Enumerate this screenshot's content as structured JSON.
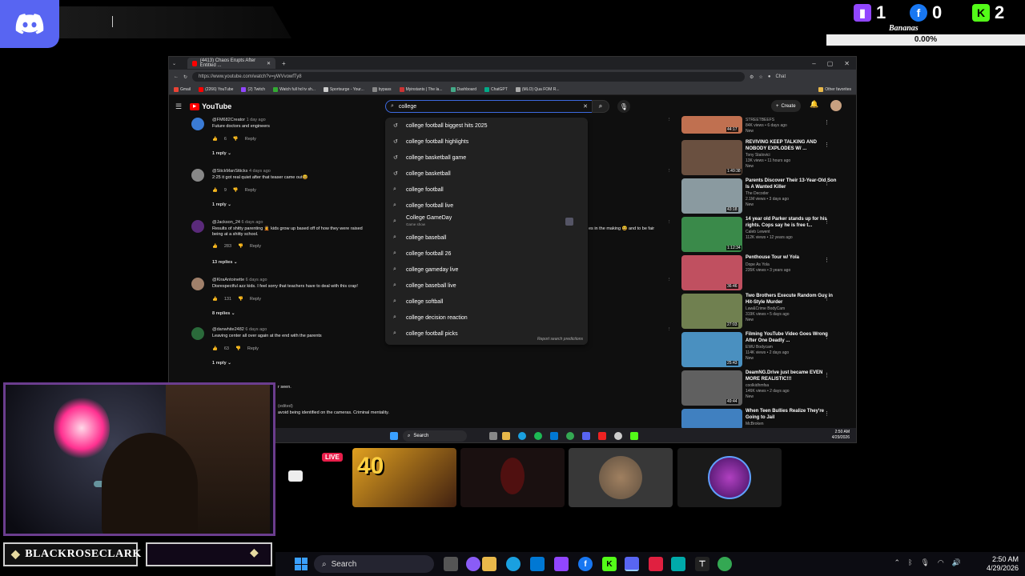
{
  "overlay": {
    "social": [
      {
        "icon": "twitch-icon",
        "count": "1",
        "color": "#9146ff"
      },
      {
        "icon": "facebook-icon",
        "count": "0",
        "color": "#1877f2"
      },
      {
        "icon": "kick-icon",
        "count": "2",
        "color": "#53fc18"
      }
    ],
    "bananas_label": "Bananas",
    "bananas_value": "0.00%",
    "streamer_name": "BLACKROSECLARK",
    "live_badge": "LIVE",
    "tile_text": "40"
  },
  "browser": {
    "tab_title": "(4413) Chaos Erupts After Entitled ...",
    "url": "https://www.youtube.com/watch?v=yWVvowfTy8",
    "bookmarks": [
      "Gmail",
      "(2266) YouTube",
      "(2) Twitch",
      "Watch full hd tv sh...",
      "Sportsurge - Your...",
      "bypass",
      "Myinstants | The la...",
      "Dashboard",
      "ChatGPT",
      "(MLO) Qua FOM R...",
      "Other favorites"
    ],
    "chat_label": "Chat"
  },
  "youtube": {
    "logo": "YouTube",
    "search_value": "college",
    "create_label": "Create",
    "notif_count": "9+",
    "suggestions": [
      {
        "icon": "history",
        "text": "college football biggest hits 2025"
      },
      {
        "icon": "history",
        "text": "college football highlights"
      },
      {
        "icon": "history",
        "text": "college basketball game"
      },
      {
        "icon": "history",
        "text": "college basketball"
      },
      {
        "icon": "search",
        "text": "college football"
      },
      {
        "icon": "search",
        "text": "college football live"
      },
      {
        "icon": "search",
        "text": "College GameDay",
        "sub": "Game show"
      },
      {
        "icon": "search",
        "text": "college baseball"
      },
      {
        "icon": "search",
        "text": "college football 26"
      },
      {
        "icon": "search",
        "text": "college gameday live"
      },
      {
        "icon": "search",
        "text": "college baseball live"
      },
      {
        "icon": "search",
        "text": "college softball"
      },
      {
        "icon": "search",
        "text": "college decision reaction"
      },
      {
        "icon": "search",
        "text": "college football picks"
      }
    ],
    "report_label": "Report search predictions",
    "comments": [
      {
        "author": "@FM682Creator",
        "time": "1 day ago",
        "text": "Future doctors and engineers",
        "likes": "6",
        "reply": "Reply",
        "replies": "1 reply",
        "avatar": "#3a7bd5"
      },
      {
        "author": "@StickManStticks",
        "time": "4 days ago",
        "text": "2:25 it got real quiet after that teaser came out😆",
        "likes": "9",
        "reply": "Reply",
        "replies": "1 reply",
        "avatar": "#888"
      },
      {
        "author": "@Jackson_24",
        "time": "6 days ago",
        "text": "Results of shitty parenting 🤦 kids grow up based off of how they were raised",
        "text2": "es in the making 😆 and to be fair",
        "text3": "being at a shitty school.",
        "likes": "283",
        "reply": "Reply",
        "replies": "13 replies",
        "avatar": "#5a2a7a"
      },
      {
        "author": "@KiraAntoinette",
        "time": "6 days ago",
        "text": "Disrespectful azz kids. I feel sorry that teachers have to deal with this crap!",
        "likes": "131",
        "reply": "Reply",
        "replies": "8 replies",
        "avatar": "#a0806a"
      },
      {
        "author": "@danwhite2482",
        "time": "6 days ago",
        "text": "Leaving center all over again at the end with the parents",
        "likes": "63",
        "reply": "Reply",
        "replies": "1 reply",
        "avatar": "#2a6a3a"
      }
    ],
    "partial_text_1": "r seen.",
    "partial_text_2": "(edited)",
    "partial_text_3": "avoid being identified on the cameras.  Criminal mentality.",
    "related": [
      {
        "title": "",
        "channel": "STREETBEEFS",
        "meta": "84K views • 6 days ago",
        "badge": "New",
        "duration": "44:17",
        "color": "#c07050"
      },
      {
        "title": "REVIVING KEEP TALKING AND NOBODY EXPLODES W/ ...",
        "channel": "Tony Stalovici",
        "meta": "13K views • 11 hours ago",
        "badge": "New",
        "duration": "1:49:38",
        "color": "#6a5040"
      },
      {
        "title": "Parents Discover Their 13-Year-Old Son Is A Wanted Killer",
        "channel": "The Decoder",
        "meta": "2.1M views • 3 days ago",
        "badge": "New",
        "duration": "43:18",
        "color": "#8a9aa0"
      },
      {
        "title": "14 year old Parker stands up for his rights. Cops say he is free t...",
        "channel": "Caleb Lewent",
        "meta": "112K views • 12 years ago",
        "badge": "",
        "duration": "1:12:34",
        "color": "#3a8a4a"
      },
      {
        "title": "Penthouse Tour w/ Yola",
        "channel": "Dope As Yola",
        "meta": "235K views • 3 years ago",
        "badge": "",
        "duration": "36:46",
        "color": "#c05060"
      },
      {
        "title": "Two Brothers Execute Random Guy in Hit-Style Murder",
        "channel": "Law&Crime BodyCam",
        "meta": "319K views • 5 days ago",
        "badge": "New",
        "duration": "27:03",
        "color": "#708050"
      },
      {
        "title": "Filming YouTube Video Goes Wrong After One Deadly ...",
        "channel": "EWU Bodycam",
        "meta": "114K views • 2 days ago",
        "badge": "New",
        "duration": "25:43",
        "color": "#4a90c0"
      },
      {
        "title": "DeamNG.Drive just became EVEN MORE REALISTIC!!!",
        "channel": "coolkidhmfsa",
        "meta": "146K views • 2 days ago",
        "badge": "New",
        "duration": "49:44",
        "color": "#606060"
      },
      {
        "title": "When Teen Bullies Realize They're Going to Jail",
        "channel": "McBroken",
        "meta": "",
        "badge": "",
        "duration": "",
        "color": "#4080c0"
      }
    ]
  },
  "inner_taskbar": {
    "search": "Search",
    "time": "2:50 AM",
    "date": "4/29/2026"
  },
  "taskbar": {
    "search": "Search",
    "time": "2:50 AM",
    "date": "4/29/2026"
  }
}
